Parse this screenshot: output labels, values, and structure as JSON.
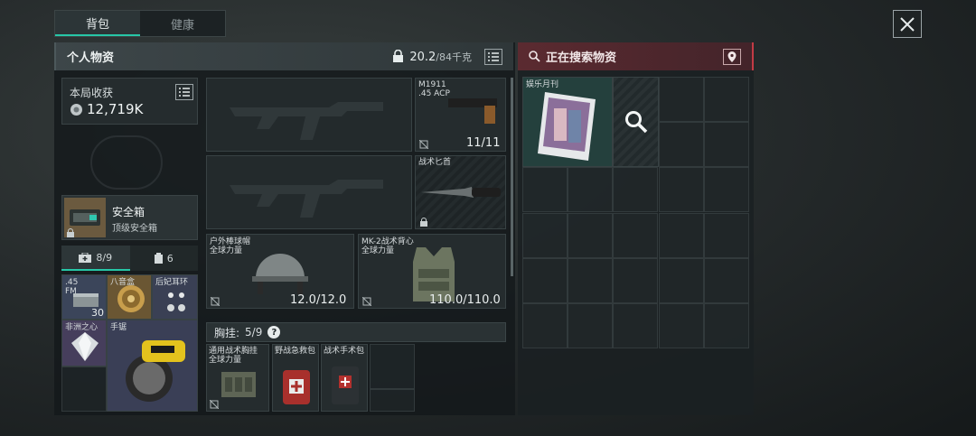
{
  "tabs": [
    {
      "label": "背包",
      "active": true
    },
    {
      "label": "健康",
      "active": false
    }
  ],
  "inventory": {
    "title": "个人物资",
    "weight_current": "20.2",
    "weight_max": "/84千克",
    "harvest_label": "本局收获",
    "harvest_value": "12,719K",
    "weapon_slots": [
      {
        "name": "M1911",
        "caliber": ".45 ACP",
        "ammo": "11/11"
      },
      {
        "name": "战术匕首"
      }
    ],
    "helmet": {
      "name": "户外棒球帽",
      "sub": "全球力量",
      "durability": "12.0/12.0"
    },
    "armor": {
      "name": "MK-2战术背心",
      "sub": "全球力量",
      "durability": "110.0/110.0"
    },
    "safebox": {
      "title": "安全箱",
      "sub": "顶级安全箱"
    },
    "count_tabs": [
      {
        "label": "8/9",
        "active": true
      },
      {
        "label": "6",
        "active": false
      }
    ],
    "pouch_items": [
      {
        "label": ".45\nFM",
        "count": "30"
      },
      {
        "label": "八音盒"
      },
      {
        "label": "后妃耳环"
      },
      {
        "label": "非洲之心"
      },
      {
        "label": "手锯"
      }
    ],
    "chest_rig": {
      "label": "胸挂:",
      "count": "5/9"
    },
    "rig_items": [
      {
        "name": "通用战术胸挂",
        "sub": "全球力量"
      },
      {
        "name": "野战急救包"
      },
      {
        "name": "战术手术包"
      }
    ]
  },
  "search": {
    "title": "正在搜索物资",
    "found_item": "娱乐月刊"
  },
  "colors": {
    "accent": "#27c7a7",
    "search_accent": "#c23b45"
  }
}
